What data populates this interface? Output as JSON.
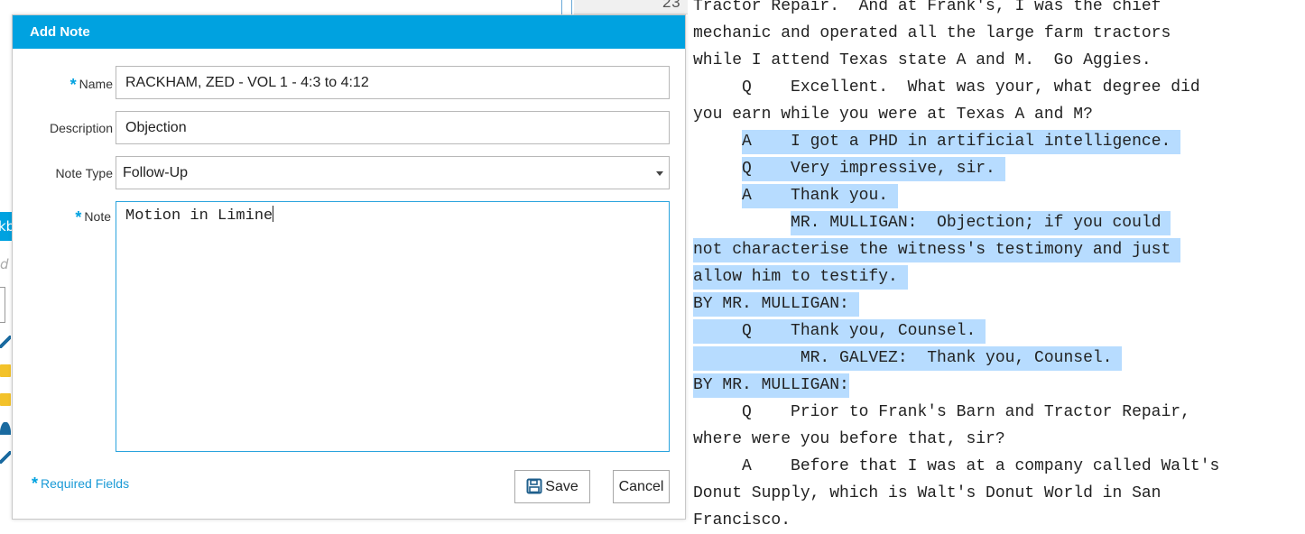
{
  "dialog": {
    "title": "Add Note",
    "fields": {
      "name": {
        "label": "Name",
        "value": "RACKHAM, ZED - VOL 1 - 4:3 to 4:12",
        "required": true
      },
      "description": {
        "label": "Description",
        "value": "Objection"
      },
      "note_type": {
        "label": "Note Type",
        "value": "Follow-Up"
      },
      "note": {
        "label": "Note",
        "value": "Motion in Limine",
        "required": true
      }
    },
    "required_marker": "*",
    "required_fields_text": "Required Fields",
    "buttons": {
      "save": "Save",
      "cancel": "Cancel"
    }
  },
  "background": {
    "line_number": "23",
    "left_fragments": {
      "tab_text": "kb",
      "italic_text": "d"
    }
  },
  "transcript": [
    {
      "text": "Tractor Repair.  And at Frank's, I was the chief",
      "highlight": false
    },
    {
      "text": "mechanic and operated all the large farm tractors",
      "highlight": false
    },
    {
      "text": "while I attend Texas state A and M.  Go Aggies.",
      "highlight": false
    },
    {
      "text": "     Q    Excellent.  What was your, what degree did",
      "highlight": false
    },
    {
      "text": "you earn while you were at Texas A and M?",
      "highlight": false
    },
    {
      "text": "     A    I got a PHD in artificial intelligence. ",
      "highlight": true,
      "indent": 5
    },
    {
      "text": "     Q    Very impressive, sir. ",
      "highlight": true,
      "indent": 5
    },
    {
      "text": "     A    Thank you. ",
      "highlight": true,
      "indent": 5
    },
    {
      "text": "          MR. MULLIGAN:  Objection; if you could ",
      "highlight": true,
      "indent": 10
    },
    {
      "text": "not characterise the witness's testimony and just ",
      "highlight": true,
      "indent": 0
    },
    {
      "text": "allow him to testify. ",
      "highlight": true,
      "indent": 0
    },
    {
      "text": "BY MR. MULLIGAN: ",
      "highlight": true,
      "indent": 0
    },
    {
      "text": "     Q    Thank you, Counsel. ",
      "highlight": true,
      "indent": 0
    },
    {
      "text": "           MR. GALVEZ:  Thank you, Counsel. ",
      "highlight": true,
      "indent": 0
    },
    {
      "text": "BY MR. MULLIGAN:",
      "highlight": true,
      "indent": 0
    },
    {
      "text": "     Q    Prior to Frank's Barn and Tractor Repair,",
      "highlight": false
    },
    {
      "text": "where were you before that, sir?",
      "highlight": false
    },
    {
      "text": "     A    Before that I was at a company called Walt's",
      "highlight": false
    },
    {
      "text": "Donut Supply, which is Walt's Donut World in San",
      "highlight": false
    },
    {
      "text": "Francisco.",
      "highlight": false
    }
  ],
  "colors": {
    "accent": "#00a2e0",
    "highlight": "#b7dcff",
    "required": "#1a9ad6"
  },
  "icons": {
    "save": "floppy-disk-icon",
    "select_caret": "caret-down-icon"
  }
}
